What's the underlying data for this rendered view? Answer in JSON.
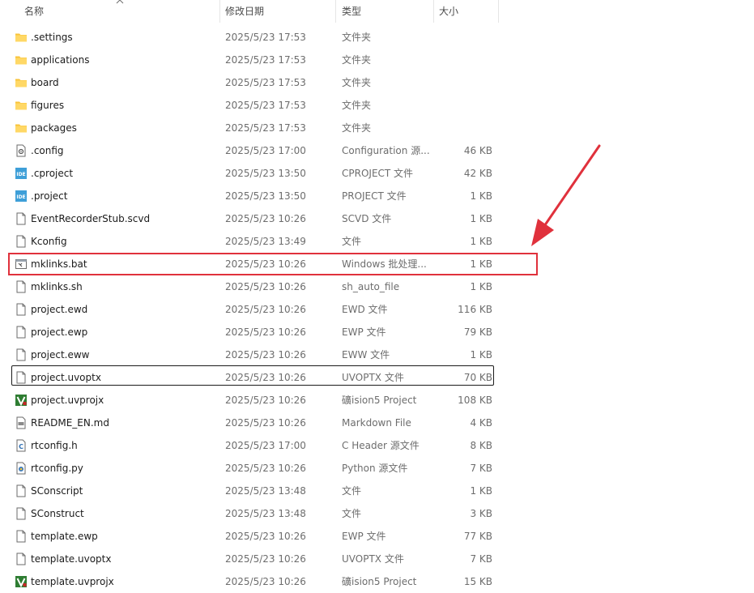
{
  "columns": {
    "name": "名称",
    "date": "修改日期",
    "type": "类型",
    "size": "大小"
  },
  "colors": {
    "annotation": "#e0313c",
    "folder": "#f8c33a",
    "ide": "#3e9fd8",
    "keil": "#2e7d32"
  },
  "files": [
    {
      "name": ".settings",
      "date": "2025/5/23 17:53",
      "type": "文件夹",
      "size": "",
      "icon": "folder-icon"
    },
    {
      "name": "applications",
      "date": "2025/5/23 17:53",
      "type": "文件夹",
      "size": "",
      "icon": "folder-icon"
    },
    {
      "name": "board",
      "date": "2025/5/23 17:53",
      "type": "文件夹",
      "size": "",
      "icon": "folder-icon"
    },
    {
      "name": "figures",
      "date": "2025/5/23 17:53",
      "type": "文件夹",
      "size": "",
      "icon": "folder-icon"
    },
    {
      "name": "packages",
      "date": "2025/5/23 17:53",
      "type": "文件夹",
      "size": "",
      "icon": "folder-icon"
    },
    {
      "name": ".config",
      "date": "2025/5/23 17:00",
      "type": "Configuration 源...",
      "size": "46 KB",
      "icon": "config-file-icon"
    },
    {
      "name": ".cproject",
      "date": "2025/5/23 13:50",
      "type": "CPROJECT 文件",
      "size": "42 KB",
      "icon": "ide-file-icon"
    },
    {
      "name": ".project",
      "date": "2025/5/23 13:50",
      "type": "PROJECT 文件",
      "size": "1 KB",
      "icon": "ide-file-icon"
    },
    {
      "name": "EventRecorderStub.scvd",
      "date": "2025/5/23 10:26",
      "type": "SCVD 文件",
      "size": "1 KB",
      "icon": "file-icon"
    },
    {
      "name": "Kconfig",
      "date": "2025/5/23 13:49",
      "type": "文件",
      "size": "1 KB",
      "icon": "file-icon"
    },
    {
      "name": "mklinks.bat",
      "date": "2025/5/23 10:26",
      "type": "Windows 批处理...",
      "size": "1 KB",
      "icon": "batch-file-icon"
    },
    {
      "name": "mklinks.sh",
      "date": "2025/5/23 10:26",
      "type": "sh_auto_file",
      "size": "1 KB",
      "icon": "file-icon"
    },
    {
      "name": "project.ewd",
      "date": "2025/5/23 10:26",
      "type": "EWD 文件",
      "size": "116 KB",
      "icon": "file-icon"
    },
    {
      "name": "project.ewp",
      "date": "2025/5/23 10:26",
      "type": "EWP 文件",
      "size": "79 KB",
      "icon": "file-icon"
    },
    {
      "name": "project.eww",
      "date": "2025/5/23 10:26",
      "type": "EWW 文件",
      "size": "1 KB",
      "icon": "file-icon"
    },
    {
      "name": "project.uvoptx",
      "date": "2025/5/23 10:26",
      "type": "UVOPTX 文件",
      "size": "70 KB",
      "icon": "file-icon"
    },
    {
      "name": "project.uvprojx",
      "date": "2025/5/23 10:26",
      "type": "礦ision5 Project",
      "size": "108 KB",
      "icon": "keil-project-icon"
    },
    {
      "name": "README_EN.md",
      "date": "2025/5/23 10:26",
      "type": "Markdown File",
      "size": "4 KB",
      "icon": "markdown-file-icon"
    },
    {
      "name": "rtconfig.h",
      "date": "2025/5/23 17:00",
      "type": "C Header 源文件",
      "size": "8 KB",
      "icon": "c-header-file-icon"
    },
    {
      "name": "rtconfig.py",
      "date": "2025/5/23 10:26",
      "type": "Python 源文件",
      "size": "7 KB",
      "icon": "python-file-icon"
    },
    {
      "name": "SConscript",
      "date": "2025/5/23 13:48",
      "type": "文件",
      "size": "1 KB",
      "icon": "file-icon"
    },
    {
      "name": "SConstruct",
      "date": "2025/5/23 13:48",
      "type": "文件",
      "size": "3 KB",
      "icon": "file-icon"
    },
    {
      "name": "template.ewp",
      "date": "2025/5/23 10:26",
      "type": "EWP 文件",
      "size": "77 KB",
      "icon": "file-icon"
    },
    {
      "name": "template.uvoptx",
      "date": "2025/5/23 10:26",
      "type": "UVOPTX 文件",
      "size": "7 KB",
      "icon": "file-icon"
    },
    {
      "name": "template.uvprojx",
      "date": "2025/5/23 10:26",
      "type": "礦ision5 Project",
      "size": "15 KB",
      "icon": "keil-project-icon"
    }
  ]
}
